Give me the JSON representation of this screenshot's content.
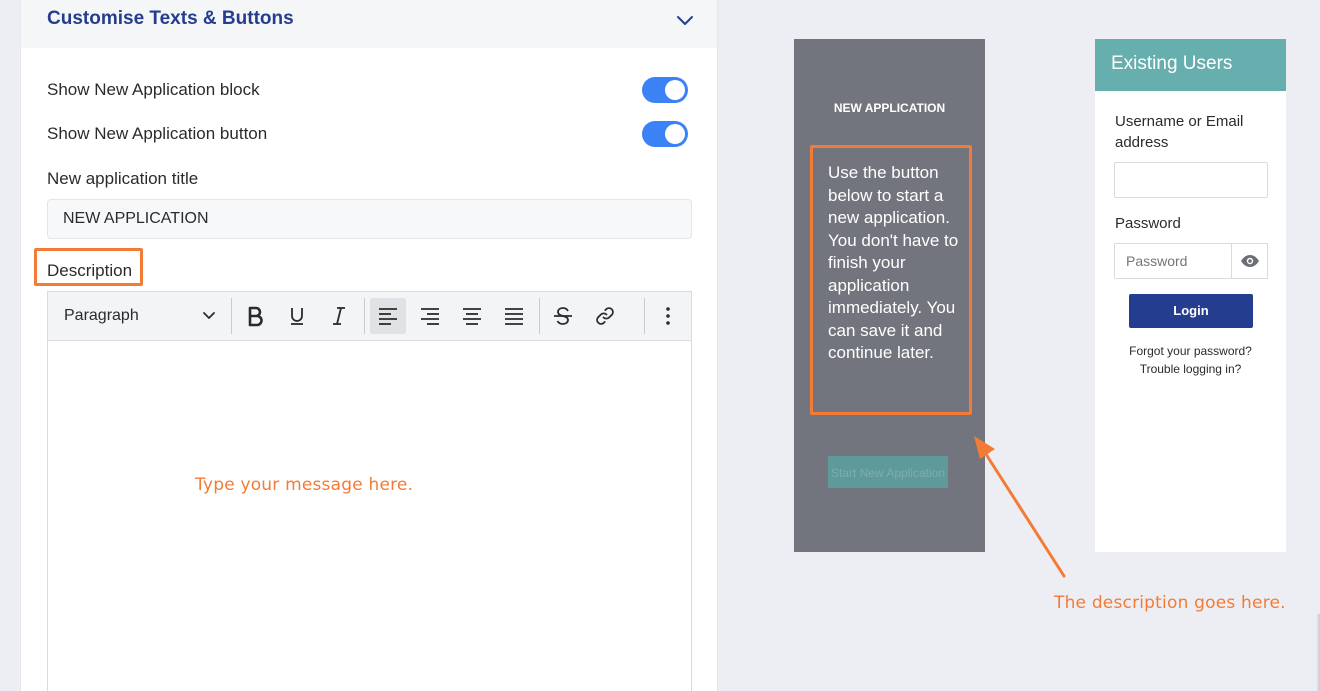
{
  "settings": {
    "section_title": "Customise Texts & Buttons",
    "show_block_label": "Show New Application block",
    "show_block_on": true,
    "show_button_label": "Show New Application button",
    "show_button_on": true,
    "title_label": "New application title",
    "title_value": "NEW APPLICATION",
    "description_label": "Description",
    "toolbar": {
      "format_select": "Paragraph",
      "buttons": [
        "bold-icon",
        "underline-icon",
        "italic-icon",
        "align-left-icon",
        "align-right-icon",
        "align-center-icon",
        "align-justify-icon",
        "strikethrough-icon",
        "link-icon",
        "more-vertical-icon"
      ],
      "active": "align-left-icon"
    },
    "editor_annotation": "Type your message here."
  },
  "preview": {
    "new_app_title": "NEW APPLICATION",
    "new_app_description": "Use the button below to start a new application. You don't have to finish your application immediately. You can save it and continue later.",
    "start_button": "Start New Application",
    "existing_title": "Existing Users",
    "username_label": "Username or Email address",
    "password_label": "Password",
    "password_placeholder": "Password",
    "login_button": "Login",
    "forgot_link": "Forgot your password?",
    "trouble_link": "Trouble logging in?"
  },
  "annotation_right": "The description goes here.",
  "colors": {
    "accent": "#f37b36",
    "toggle_on": "#3b82f6",
    "brand_navy": "#253d8f",
    "teal": "#67aeae",
    "preview_gray": "#72757e"
  }
}
